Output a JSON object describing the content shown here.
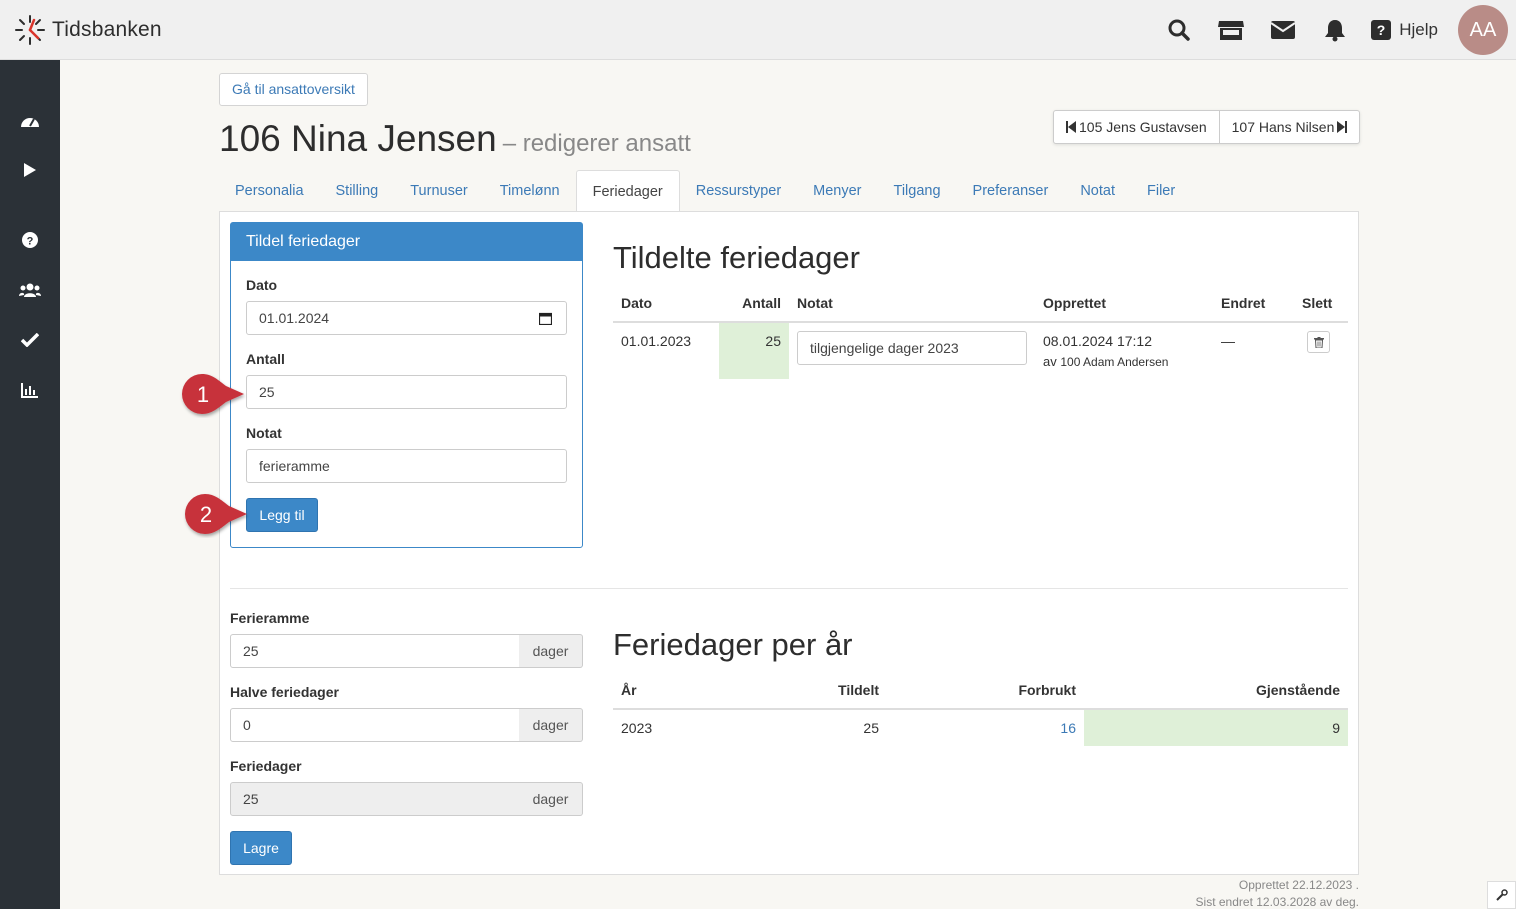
{
  "app": {
    "logo_text": "Tidsbanken",
    "help_label": "Hjelp",
    "avatar_initials": "AA"
  },
  "header": {
    "goto_button": "Gå til ansattoversikt",
    "title": "106 Nina Jensen",
    "subtitle": "– redigerer ansatt",
    "prev_employee": "105 Jens Gustavsen",
    "next_employee": "107 Hans Nilsen"
  },
  "tabs": [
    {
      "label": "Personalia"
    },
    {
      "label": "Stilling"
    },
    {
      "label": "Turnuser"
    },
    {
      "label": "Timelønn"
    },
    {
      "label": "Feriedager"
    },
    {
      "label": "Ressurstyper"
    },
    {
      "label": "Menyer"
    },
    {
      "label": "Tilgang"
    },
    {
      "label": "Preferanser"
    },
    {
      "label": "Notat"
    },
    {
      "label": "Filer"
    }
  ],
  "assign_panel": {
    "title": "Tildel feriedager",
    "date_label": "Dato",
    "date_value": "01.01.2024",
    "count_label": "Antall",
    "count_value": "25",
    "note_label": "Notat",
    "note_value": "ferieramme",
    "add_button": "Legg til"
  },
  "callouts": {
    "one": "1",
    "two": "2"
  },
  "assigned": {
    "title": "Tildelte feriedager",
    "headers": {
      "date": "Dato",
      "count": "Antall",
      "note": "Notat",
      "created": "Opprettet",
      "changed": "Endret",
      "delete": "Slett"
    },
    "row": {
      "date": "01.01.2023",
      "count": "25",
      "note": "tilgjengelige dager 2023",
      "created": "08.01.2024 17:12",
      "created_by_prefix": "av",
      "created_by": "100 Adam Andersen",
      "changed": "—"
    }
  },
  "settings": {
    "frame_label": "Ferieramme",
    "frame_value": "25",
    "half_label": "Halve feriedager",
    "half_value": "0",
    "days_label": "Feriedager",
    "days_value": "25",
    "unit": "dager",
    "save_button": "Lagre"
  },
  "per_year": {
    "title": "Feriedager per år",
    "headers": {
      "year": "År",
      "assigned": "Tildelt",
      "used": "Forbrukt",
      "remaining": "Gjenstående"
    },
    "row": {
      "year": "2023",
      "assigned": "25",
      "used": "16",
      "remaining": "9"
    }
  },
  "footer": {
    "created": "Opprettet 22.12.2023 .",
    "changed": "Sist endret 12.03.2028 av deg."
  },
  "colors": {
    "primary": "#3c88c8",
    "link": "#3c7ab6",
    "sidebar": "#2b3137",
    "success_bg": "#dff0d8",
    "callout": "#c7303a"
  }
}
